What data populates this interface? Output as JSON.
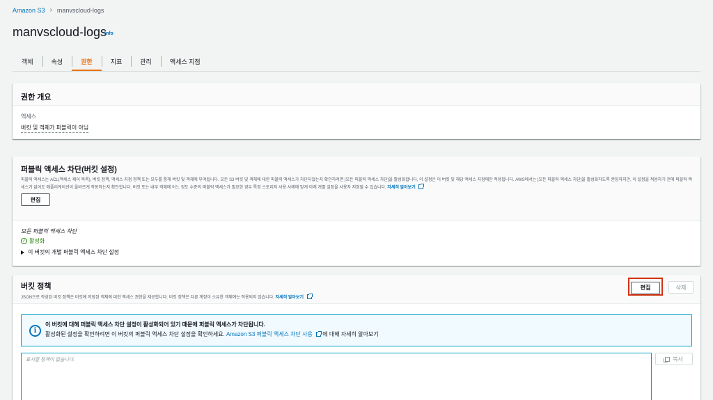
{
  "breadcrumb": {
    "root": "Amazon S3",
    "current": "manvscloud-logs"
  },
  "page": {
    "title": "manvscloud-logs",
    "info": "Info"
  },
  "tabs": [
    {
      "label": "객체"
    },
    {
      "label": "속성"
    },
    {
      "label": "권한",
      "active": true
    },
    {
      "label": "지표"
    },
    {
      "label": "관리"
    },
    {
      "label": "액세스 지점"
    }
  ],
  "overview": {
    "title": "권한 개요",
    "access_label": "액세스",
    "access_value": "버킷 및 객체가 퍼블릭이 아님"
  },
  "block_public": {
    "title": "퍼블릭 액세스 차단(버킷 설정)",
    "description": "퍼블릭 액세스는 ACL(액세스 제어 목록), 버킷 정책, 액세스 지점 정책 또는 모두를 통해 버킷 및 객체에 부여됩니다. 모든 S3 버킷 및 객체에 대한 퍼블릭 액세스가 차단되었는지 확인하려면 [모든 퍼블릭 액세스 차단]을 활성화합니다. 이 설정은 이 버킷 및 해당 액세스 지점에만 적용됩니다. AWS에서는 [모든 퍼블릭 액세스 차단]을 활성화하도록 권장하지만, 이 설정을 적용하기 전에 퍼블릭 액세스가 없어도 애플리케이션이 올바르게 작동하는지 확인합니다. 버킷 또는 내부 객체에 어느 정도 수준의 퍼블릭 액세스가 필요한 경우 특정 스토리지 사용 사례에 맞게 아래 개별 설정을 사용자 지정할 수 있습니다.",
    "learn_more": "자세히 알아보기",
    "edit_label": "편집",
    "block_all_label": "모든 퍼블릭 액세스 차단",
    "block_all_label_rest": " 퍼블릭 액세스 차단",
    "status": "활성화",
    "expander_label": "이 버킷의 개별 퍼블릭 액세스 차단 설정"
  },
  "bucket_policy": {
    "title": "버킷 정책",
    "description": "JSON으로 작성된 버킷 정책은 버킷에 저장된 객체에 대한 액세스 권한을 제공합니다. 버킷 정책은 다른 계정이 소유한 객체에는 적용되지 않습니다.",
    "learn_more": "자세히 알아보기",
    "edit_label": "편집",
    "delete_label": "삭제",
    "alert_title": "이 버킷에 대해 퍼블릭 액세스 차단 설정이 활성화되어 있기 때문에 퍼블릭 액세스가 차단됩니다.",
    "alert_text_1": "활성화된 설정을 확인하려면 이 버킷의 퍼블릭 액세스 차단 설정을 확인하세요. ",
    "alert_link": "Amazon S3 퍼블릭 액세스 차단 사용",
    "alert_text_2": "에 대해 자세히 알아보기",
    "editor_placeholder": "표시할 정책이 없습니다.",
    "copy_label": "복사"
  },
  "colors": {
    "accent": "#ec7211",
    "link": "#0073bb",
    "success": "#1d8102",
    "highlight": "#d13212",
    "info_border": "#00a1c9"
  }
}
